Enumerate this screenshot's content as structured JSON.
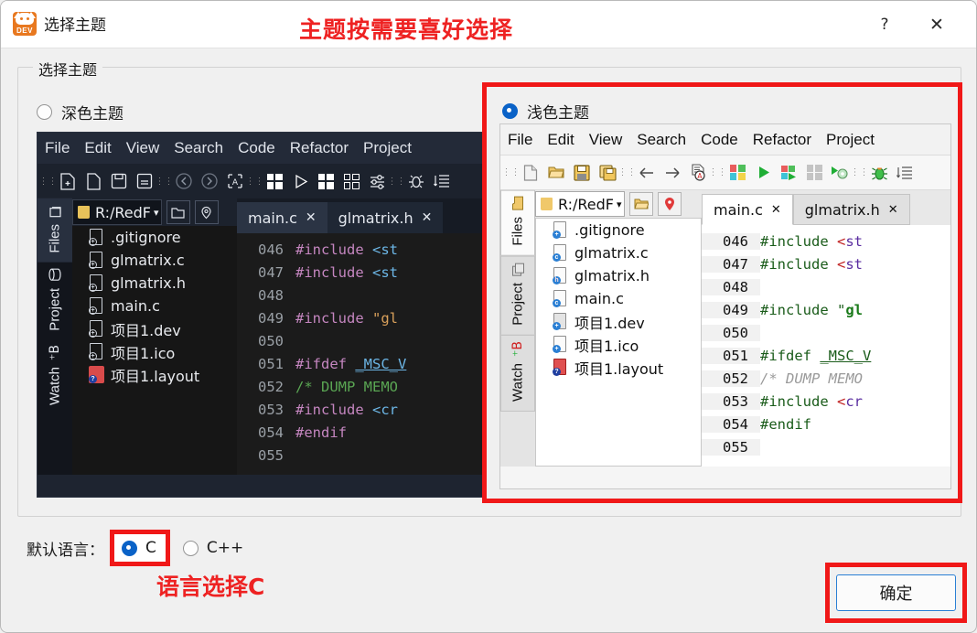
{
  "window": {
    "title": "选择主题",
    "app_icon": "devcpp-icon",
    "icon_text": "DEV",
    "help_label": "?",
    "close_label": "✕"
  },
  "annotations": {
    "top": "主题按需要喜好选择",
    "language": "语言选择C",
    "color": "#ee2222"
  },
  "groupbox": {
    "legend": "选择主题"
  },
  "themes": {
    "dark": {
      "label": "深色主题",
      "selected": false
    },
    "light": {
      "label": "浅色主题",
      "selected": true
    },
    "accent": "#0a62c7"
  },
  "preview": {
    "menu": [
      "File",
      "Edit",
      "View",
      "Search",
      "Code",
      "Refactor",
      "Project"
    ],
    "toolbar_icons": [
      "new-project-icon",
      "new-file-icon",
      "save-icon",
      "save-all-icon",
      "separator",
      "back-icon",
      "forward-icon",
      "find-icon",
      "separator",
      "compile-icon",
      "run-icon",
      "compile-run-icon",
      "rebuild-icon",
      "separator",
      "profile-icon",
      "separator",
      "debug-icon",
      "indent-icon"
    ],
    "vtabs": [
      {
        "label": "Files",
        "icon": "files-icon",
        "active": true
      },
      {
        "label": "Project",
        "icon": "project-icon",
        "active": false
      },
      {
        "label": "Watch",
        "icon": "watch-icon",
        "active": false
      }
    ],
    "path": "R:/RedF",
    "path_icon": "folder-icon",
    "path_dropdown": "▾",
    "path_buttons": [
      "open-folder-icon",
      "locate-icon"
    ],
    "files": [
      {
        "name": ".gitignore",
        "badge": ""
      },
      {
        "name": "glmatrix.c",
        "badge": "c"
      },
      {
        "name": "glmatrix.h",
        "badge": "h"
      },
      {
        "name": "main.c",
        "badge": "c"
      },
      {
        "name": "项目1.dev",
        "badge": ""
      },
      {
        "name": "项目1.ico",
        "badge": ""
      },
      {
        "name": "项目1.layout",
        "badge": "?"
      }
    ],
    "tabs": [
      {
        "label": "main.c",
        "close": "✕",
        "active": true
      },
      {
        "label": "glmatrix.h",
        "close": "✕",
        "active": false
      }
    ],
    "code": [
      {
        "num": "046",
        "text": "#include <st"
      },
      {
        "num": "047",
        "text": "#include <st"
      },
      {
        "num": "048",
        "text": ""
      },
      {
        "num": "049",
        "text": "#include \"gl"
      },
      {
        "num": "050",
        "text": ""
      },
      {
        "num": "051",
        "text": "#ifdef _MSC_V"
      },
      {
        "num": "052",
        "text": "/* DUMP MEMO"
      },
      {
        "num": "053",
        "text": "#include <cr"
      },
      {
        "num": "054",
        "text": "#endif"
      },
      {
        "num": "055",
        "text": ""
      }
    ]
  },
  "language": {
    "label": "默认语言：",
    "options": [
      {
        "label": "C",
        "selected": true
      },
      {
        "label": "C++",
        "selected": false
      }
    ]
  },
  "footer": {
    "ok_label": "确定"
  }
}
